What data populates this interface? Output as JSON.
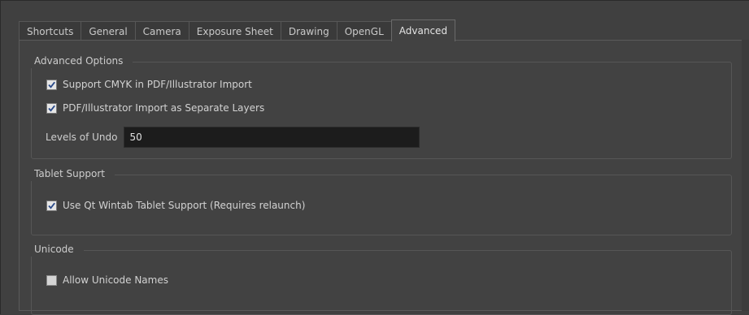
{
  "tabs": [
    {
      "label": "Shortcuts",
      "active": false
    },
    {
      "label": "General",
      "active": false
    },
    {
      "label": "Camera",
      "active": false
    },
    {
      "label": "Exposure Sheet",
      "active": false
    },
    {
      "label": "Drawing",
      "active": false
    },
    {
      "label": "OpenGL",
      "active": false
    },
    {
      "label": "Advanced",
      "active": true
    }
  ],
  "advanced_options": {
    "title": "Advanced Options",
    "cmyk": {
      "label": "Support CMYK in PDF/Illustrator Import",
      "checked": true
    },
    "separate_layers": {
      "label": "PDF/Illustrator Import as Separate Layers",
      "checked": true
    },
    "undo": {
      "label": "Levels of Undo",
      "value": "50"
    }
  },
  "tablet_support": {
    "title": "Tablet Support",
    "wintab": {
      "label": "Use Qt Wintab Tablet Support (Requires relaunch)",
      "checked": true
    }
  },
  "unicode": {
    "title": "Unicode",
    "allow_names": {
      "label": "Allow Unicode Names",
      "checked": false
    }
  },
  "colors": {
    "background": "#404040",
    "field_background": "#1c1c1c",
    "check_mark": "#2a4a8a"
  }
}
